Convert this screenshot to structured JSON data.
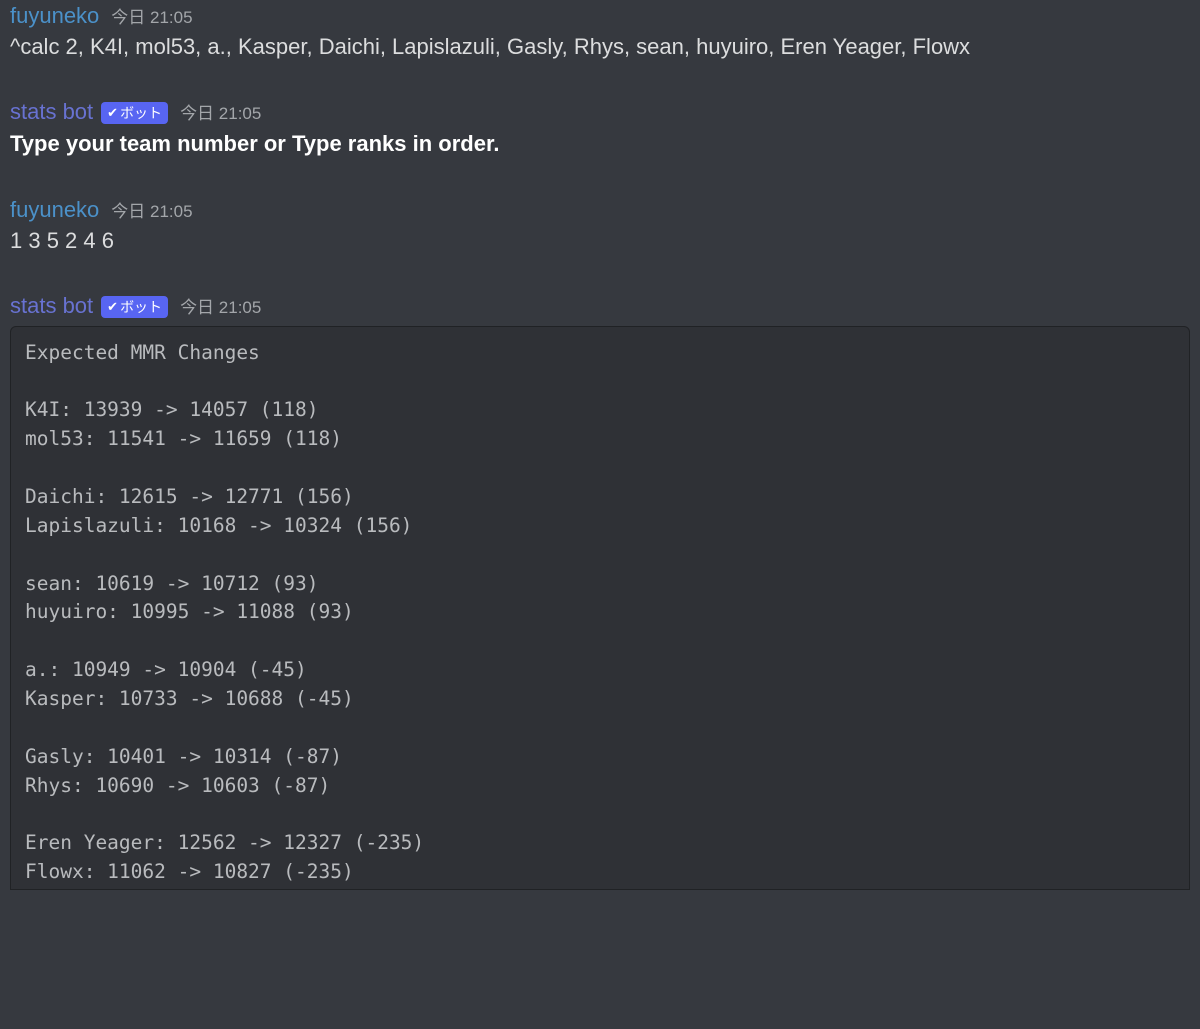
{
  "messages": [
    {
      "author": "fuyuneko",
      "author_type": "user",
      "timestamp": "今日 21:05",
      "content": "^calc 2, K4I, mol53, a., Kasper, Daichi, Lapislazuli, Gasly, Rhys, sean, huyuiro, Eren Yeager, Flowx"
    },
    {
      "author": "stats bot",
      "author_type": "bot",
      "timestamp": "今日 21:05",
      "bot_tag_text": "ボット",
      "content": "Type your team number or Type ranks in order.",
      "bold": true
    },
    {
      "author": "fuyuneko",
      "author_type": "user",
      "timestamp": "今日 21:05",
      "content": "1 3 5 2 4 6"
    },
    {
      "author": "stats bot",
      "author_type": "bot",
      "timestamp": "今日 21:05",
      "bot_tag_text": "ボット",
      "code_block": "Expected MMR Changes\n\nK4I: 13939 -> 14057 (118)\nmol53: 11541 -> 11659 (118)\n\nDaichi: 12615 -> 12771 (156)\nLapislazuli: 10168 -> 10324 (156)\n\nsean: 10619 -> 10712 (93)\nhuyuiro: 10995 -> 11088 (93)\n\na.: 10949 -> 10904 (-45)\nKasper: 10733 -> 10688 (-45)\n\nGasly: 10401 -> 10314 (-87)\nRhys: 10690 -> 10603 (-87)\n\nEren Yeager: 12562 -> 12327 (-235)\nFlowx: 11062 -> 10827 (-235)"
    }
  ]
}
